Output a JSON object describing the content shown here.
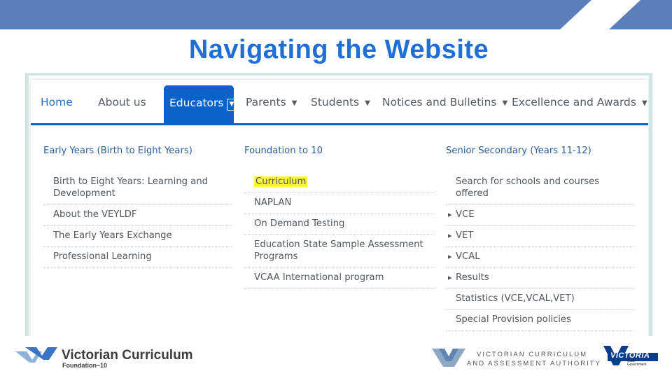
{
  "slide": {
    "title": "Navigating the Website"
  },
  "colors": {
    "band": "#5b7fb9",
    "accent": "#0b62c9",
    "title": "#1f6fd8",
    "highlight": "#fbf43a"
  },
  "nav": {
    "home": "Home",
    "about": "About us",
    "educators": "Educators",
    "parents": "Parents",
    "students": "Students",
    "notices": "Notices and Bulletins",
    "excellence": "Excellence and Awards",
    "caret": "▼"
  },
  "menu": {
    "early": {
      "heading": "Early Years (Birth to Eight Years)",
      "items": [
        "Birth to Eight Years: Learning and Development",
        "About the VEYLDF",
        "The Early Years Exchange",
        "Professional Learning"
      ]
    },
    "foundation": {
      "heading": "Foundation to 10",
      "items": [
        "Curriculum",
        "NAPLAN",
        "On Demand Testing",
        "Education State Sample Assessment Programs",
        "VCAA International program"
      ]
    },
    "senior": {
      "heading": "Senior Secondary (Years 11-12)",
      "items": [
        "Search for schools and courses offered",
        "VCE",
        "VET",
        "VCAL",
        "Results",
        "Statistics (VCE,VCAL,VET)",
        "Special Provision policies"
      ]
    }
  },
  "footer": {
    "vc_line1": "Victorian Curriculum",
    "vc_line2": "Foundation–10",
    "vcaa_line1": "VICTORIAN CURRICULUM",
    "vcaa_line2": "AND ASSESSMENT AUTHORITY",
    "vic_name": "VICTORIA",
    "vic_sub1": "State",
    "vic_sub2": "Government"
  }
}
